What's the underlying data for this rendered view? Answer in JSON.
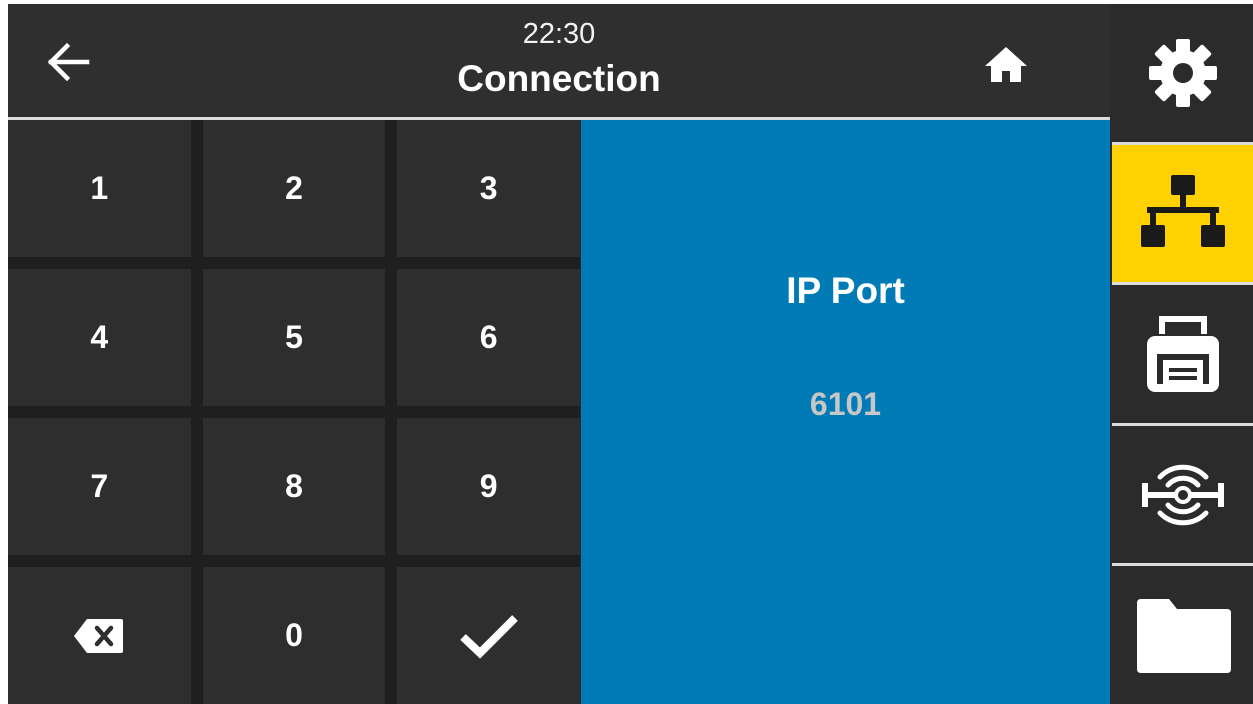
{
  "header": {
    "time": "22:30",
    "title": "Connection",
    "icons": {
      "back": "arrow-left-icon",
      "home": "home-icon"
    }
  },
  "keypad": {
    "keys": [
      "1",
      "2",
      "3",
      "4",
      "5",
      "6",
      "7",
      "8",
      "9",
      "",
      "0",
      ""
    ],
    "special": {
      "backspace": "backspace-icon",
      "confirm": "checkmark-icon"
    }
  },
  "panel": {
    "label": "IP Port",
    "value": "6101"
  },
  "sidebar": {
    "items": [
      {
        "icon": "settings-gear-icon",
        "active": false
      },
      {
        "icon": "network-connection-icon",
        "active": true
      },
      {
        "icon": "printer-icon",
        "active": false
      },
      {
        "icon": "rfid-sensor-icon",
        "active": false
      },
      {
        "icon": "folder-icon",
        "active": false
      }
    ]
  },
  "colors": {
    "panel_blue": "#007bb5",
    "active_yellow": "#ffd100",
    "key_bg": "#2e2e2e",
    "value_gray": "#c7c7c7"
  }
}
